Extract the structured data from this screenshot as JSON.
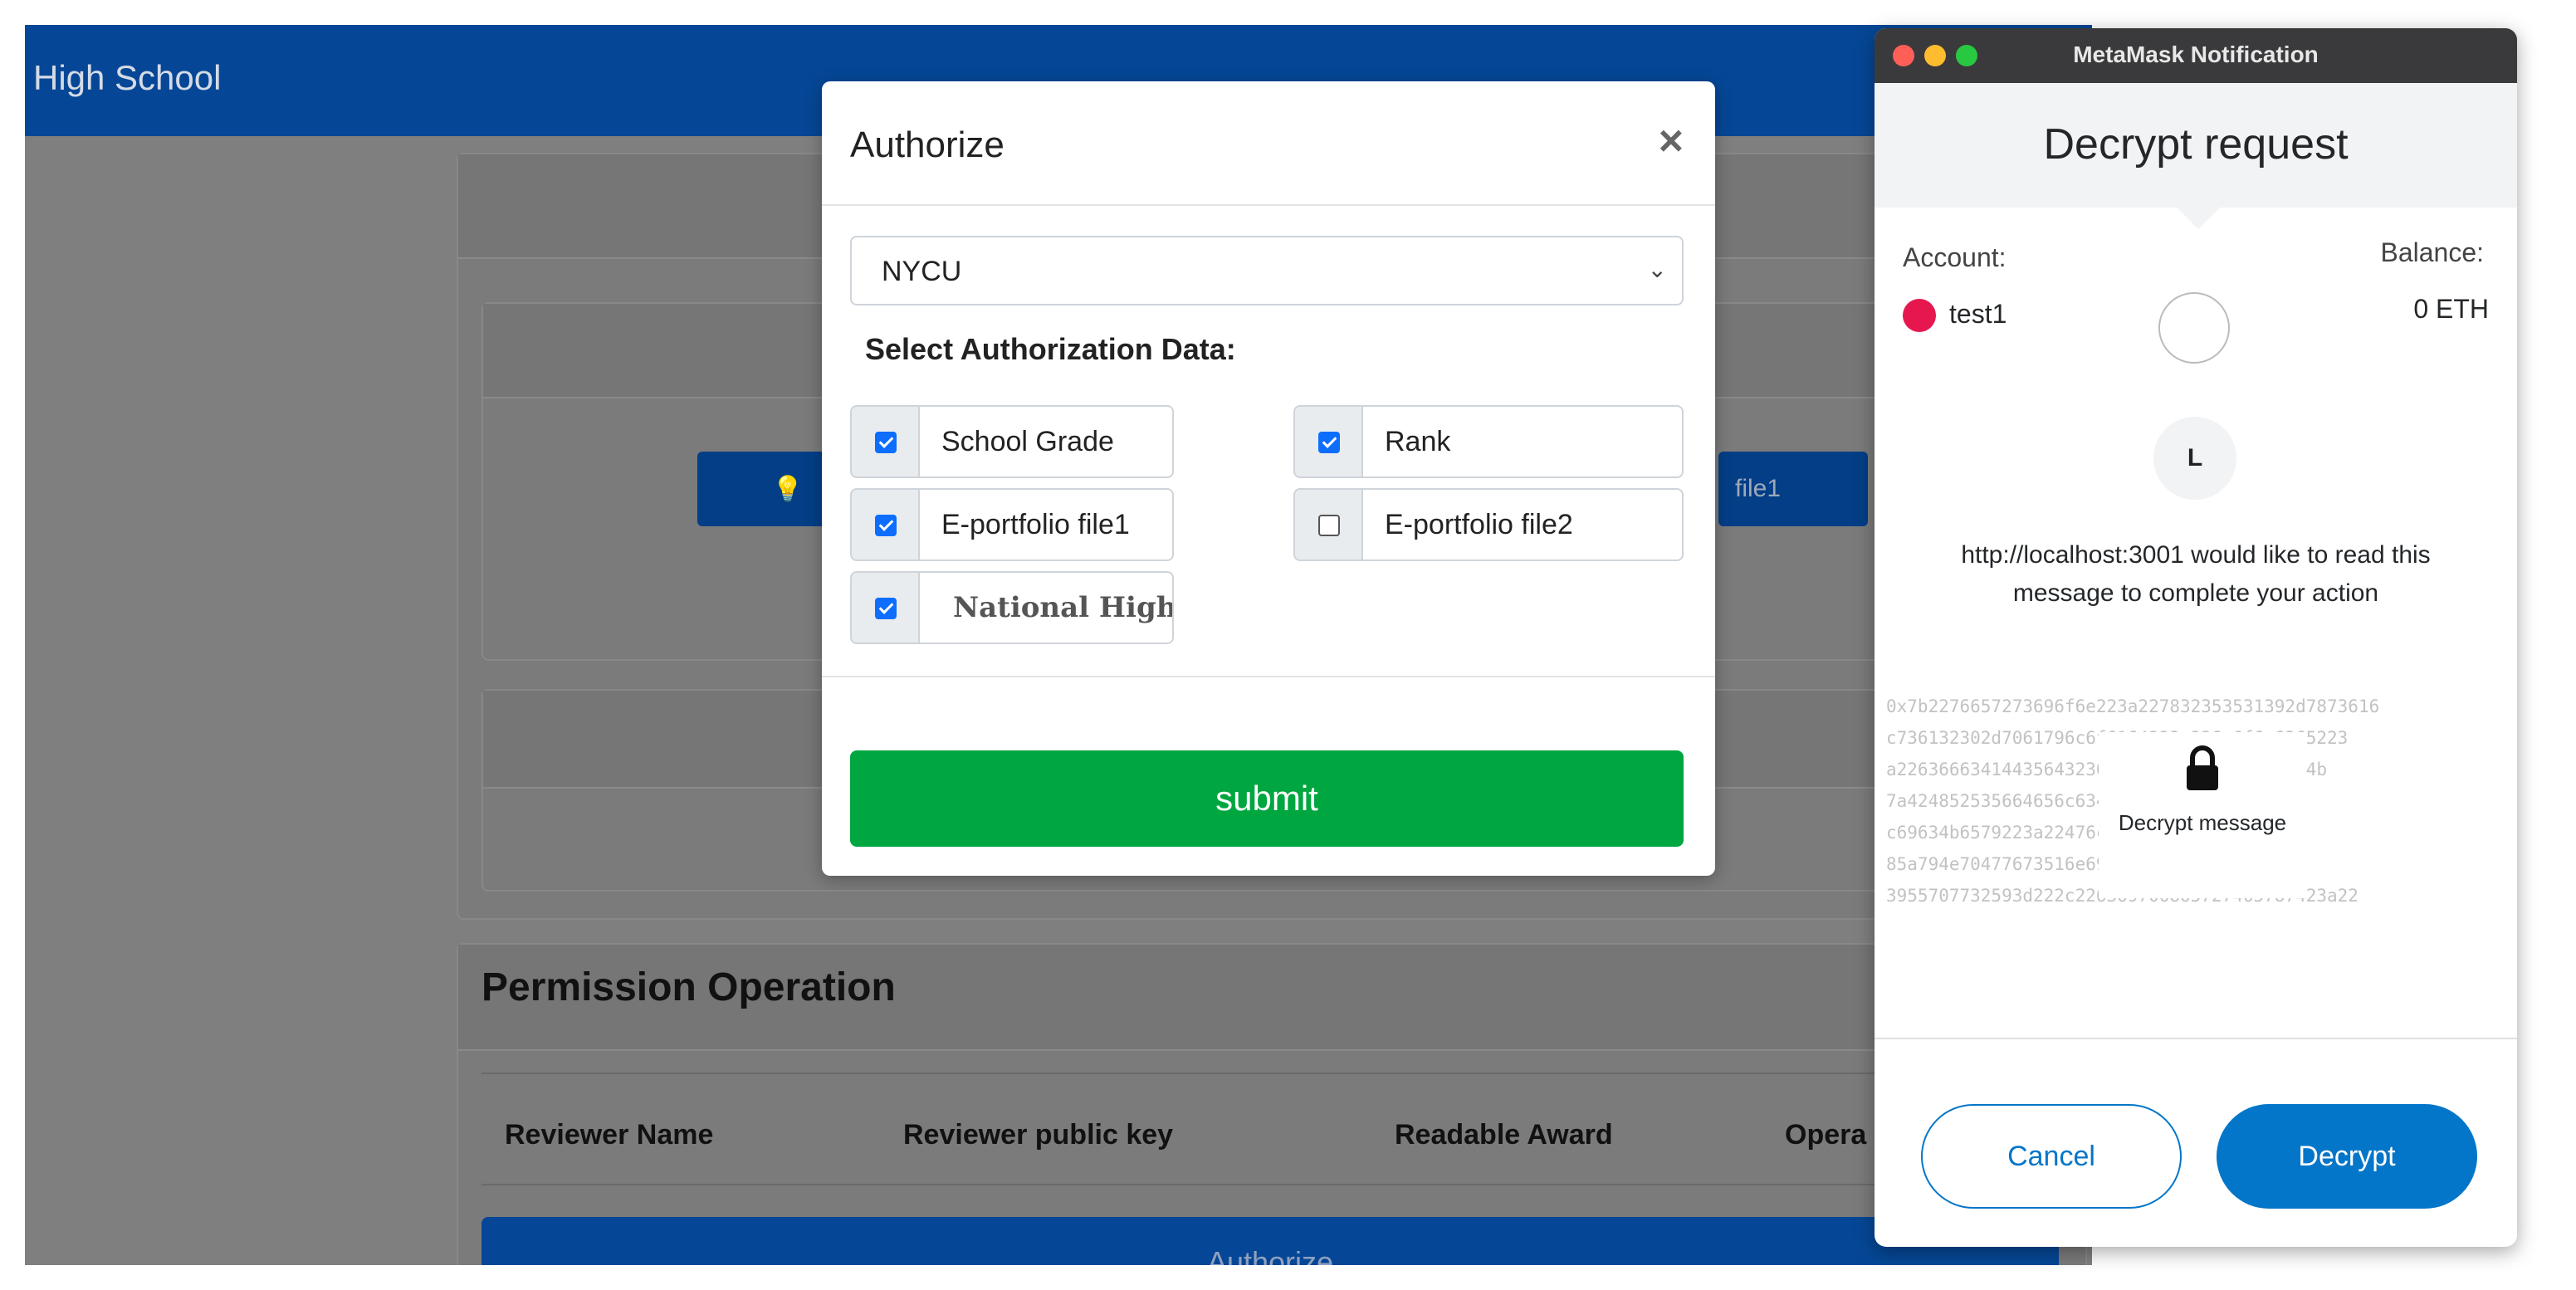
{
  "app": {
    "brand": "High School"
  },
  "background": {
    "button_right_fragment": "file1",
    "permission_title": "Permission Operation",
    "table_headers": [
      "Reviewer Name",
      "Reviewer public key",
      "Readable Award",
      "Opera"
    ],
    "authorize_button": "Authorize"
  },
  "modal": {
    "title": "Authorize",
    "close": "×",
    "select_value": "NYCU",
    "select_label": "Select Authorization Data:",
    "items": [
      {
        "label": "School Grade",
        "checked": true
      },
      {
        "label": "Rank",
        "checked": true
      },
      {
        "label": "E-portfolio file1",
        "checked": true
      },
      {
        "label": "E-portfolio file2",
        "checked": false
      },
      {
        "label": "National High S...",
        "checked": true
      }
    ],
    "submit": "submit"
  },
  "metamask": {
    "window_title": "MetaMask Notification",
    "title": "Decrypt request",
    "account_label": "Account:",
    "account_name": "test1",
    "balance_label": "Balance:",
    "balance_value": "0 ETH",
    "origin_initial": "L",
    "message": "http://localhost:3001 would like to read this message to complete your action",
    "hex_lines": [
      "0x7b2276657273696f6e223a227832353531392d7873616",
      "c736132302d7061796c6f6164222c226e6f6e6365223",
      "a2263666341443564323637726e4c3654d392b334b",
      "7a424852535664656c634d4f4d3656d5075626",
      "c69634b6579223a22476c5a5730726d46505",
      "85a794e70477673516e696d36782b4c5655",
      "3955707732593d222c226369706865727465787423a22"
    ],
    "decrypt_message_label": "Decrypt message",
    "cancel": "Cancel",
    "decrypt": "Decrypt",
    "colors": {
      "primary": "#0376c9",
      "account_dot": "#e6174e"
    }
  }
}
